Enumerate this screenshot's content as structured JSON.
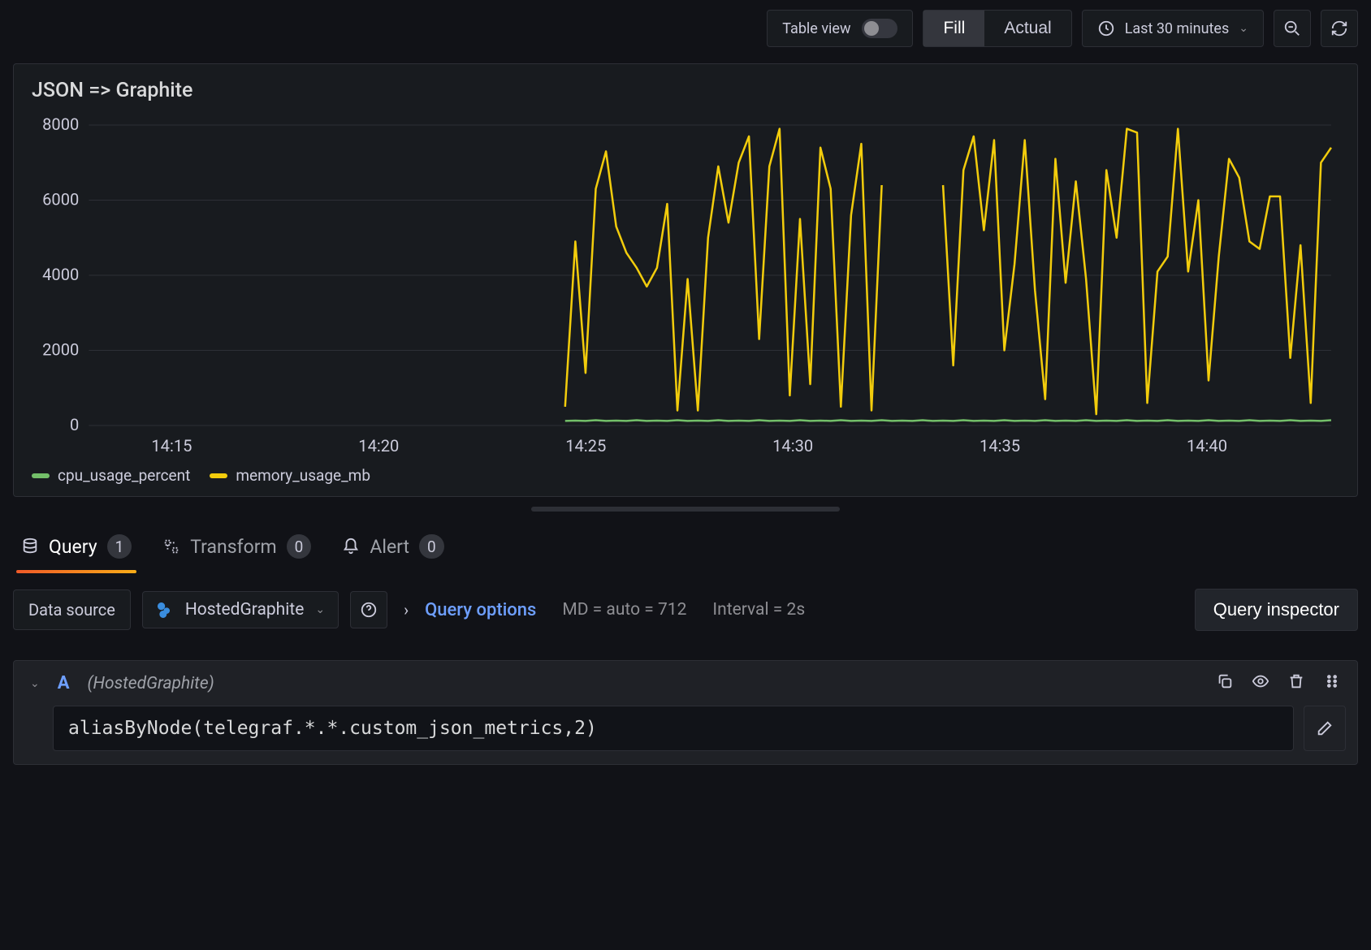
{
  "toolbar": {
    "table_view_label": "Table view",
    "fill_label": "Fill",
    "actual_label": "Actual",
    "time_range": "Last 30 minutes"
  },
  "panel": {
    "title": "JSON => Graphite"
  },
  "chart_data": {
    "type": "line",
    "title": "JSON => Graphite",
    "xlabel": "",
    "ylabel": "",
    "ylim": [
      0,
      8000
    ],
    "y_ticks": [
      0,
      2000,
      4000,
      6000,
      8000
    ],
    "x_ticks": [
      "14:15",
      "14:20",
      "14:25",
      "14:30",
      "14:35",
      "14:40"
    ],
    "x_range_minutes": [
      13,
      43
    ],
    "series": [
      {
        "name": "cpu_usage_percent",
        "color": "#73bf69",
        "x_start_min": 24.5,
        "values": [
          120,
          130,
          120,
          140,
          120,
          130,
          120,
          140,
          120,
          130,
          120,
          140,
          120,
          130,
          120,
          140,
          120,
          130,
          120,
          140,
          120,
          130,
          120,
          140,
          120,
          130,
          120,
          140,
          120,
          130,
          120,
          140,
          120,
          130,
          120,
          140,
          120,
          130,
          120,
          140,
          120,
          130,
          120,
          140,
          120,
          130,
          120,
          140,
          120,
          130,
          120,
          140,
          120,
          130,
          120,
          140,
          120,
          130,
          120,
          140,
          120,
          130,
          120,
          140,
          120,
          130,
          120,
          140,
          120,
          130,
          120,
          140,
          120,
          130,
          120,
          140
        ]
      },
      {
        "name": "memory_usage_mb",
        "color": "#f2cc0c",
        "x_start_min": 24.5,
        "values": [
          500,
          4900,
          1400,
          6300,
          7300,
          5300,
          4600,
          4200,
          3700,
          4200,
          5900,
          400,
          3900,
          400,
          5000,
          6900,
          5400,
          7000,
          7700,
          2300,
          6900,
          7900,
          800,
          5500,
          1100,
          7400,
          6300,
          500,
          5600,
          7500,
          400,
          6400,
          null,
          null,
          null,
          null,
          null,
          6400,
          1600,
          6800,
          7700,
          5200,
          7600,
          2000,
          4300,
          7600,
          3600,
          700,
          7100,
          3800,
          6500,
          3900,
          300,
          6800,
          5000,
          7900,
          7800,
          600,
          4100,
          4500,
          7900,
          4100,
          6000,
          1200,
          4500,
          7100,
          6600,
          4900,
          4700,
          6100,
          6100,
          1800,
          4800,
          600,
          7000,
          7400
        ]
      }
    ]
  },
  "legend": [
    {
      "name": "cpu_usage_percent",
      "color": "#73bf69"
    },
    {
      "name": "memory_usage_mb",
      "color": "#f2cc0c"
    }
  ],
  "tabs": {
    "query": {
      "label": "Query",
      "count": "1"
    },
    "transform": {
      "label": "Transform",
      "count": "0"
    },
    "alert": {
      "label": "Alert",
      "count": "0"
    }
  },
  "options": {
    "datasource_label": "Data source",
    "datasource_value": "HostedGraphite",
    "query_options_label": "Query options",
    "md_stat": "MD = auto = 712",
    "interval_stat": "Interval = 2s",
    "inspector_label": "Query inspector"
  },
  "query": {
    "letter": "A",
    "hint": "(HostedGraphite)",
    "text": "aliasByNode(telegraf.*.*.custom_json_metrics,2)"
  }
}
